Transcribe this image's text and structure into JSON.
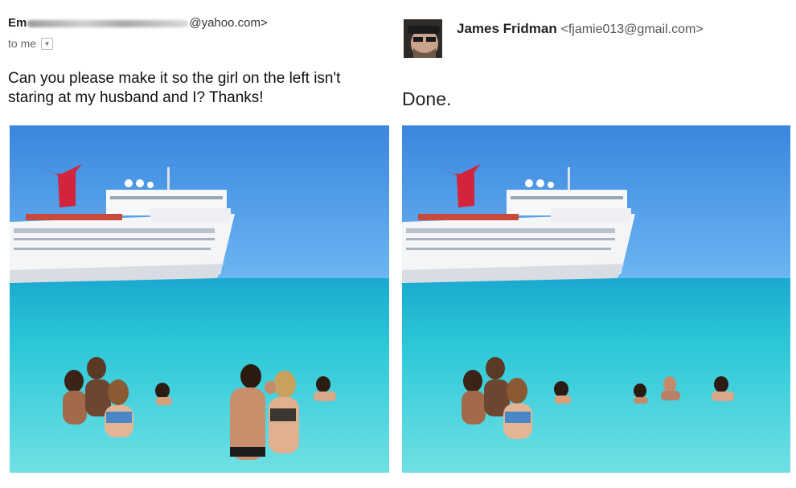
{
  "left": {
    "sender_prefix": "Em",
    "sender_domain": "@yahoo.com>",
    "recipient": "to me",
    "message": "Can you please make it so the girl on the left isn't staring at my husband and I? Thanks!"
  },
  "right": {
    "sender_name": "James Fridman",
    "sender_email": "<fjamie013@gmail.com>",
    "message": "Done."
  },
  "colors": {
    "sky": "#3d8fe0",
    "sea": "#25c6d4",
    "funnel": "#d2243a",
    "ship": "#f4f5f7"
  }
}
